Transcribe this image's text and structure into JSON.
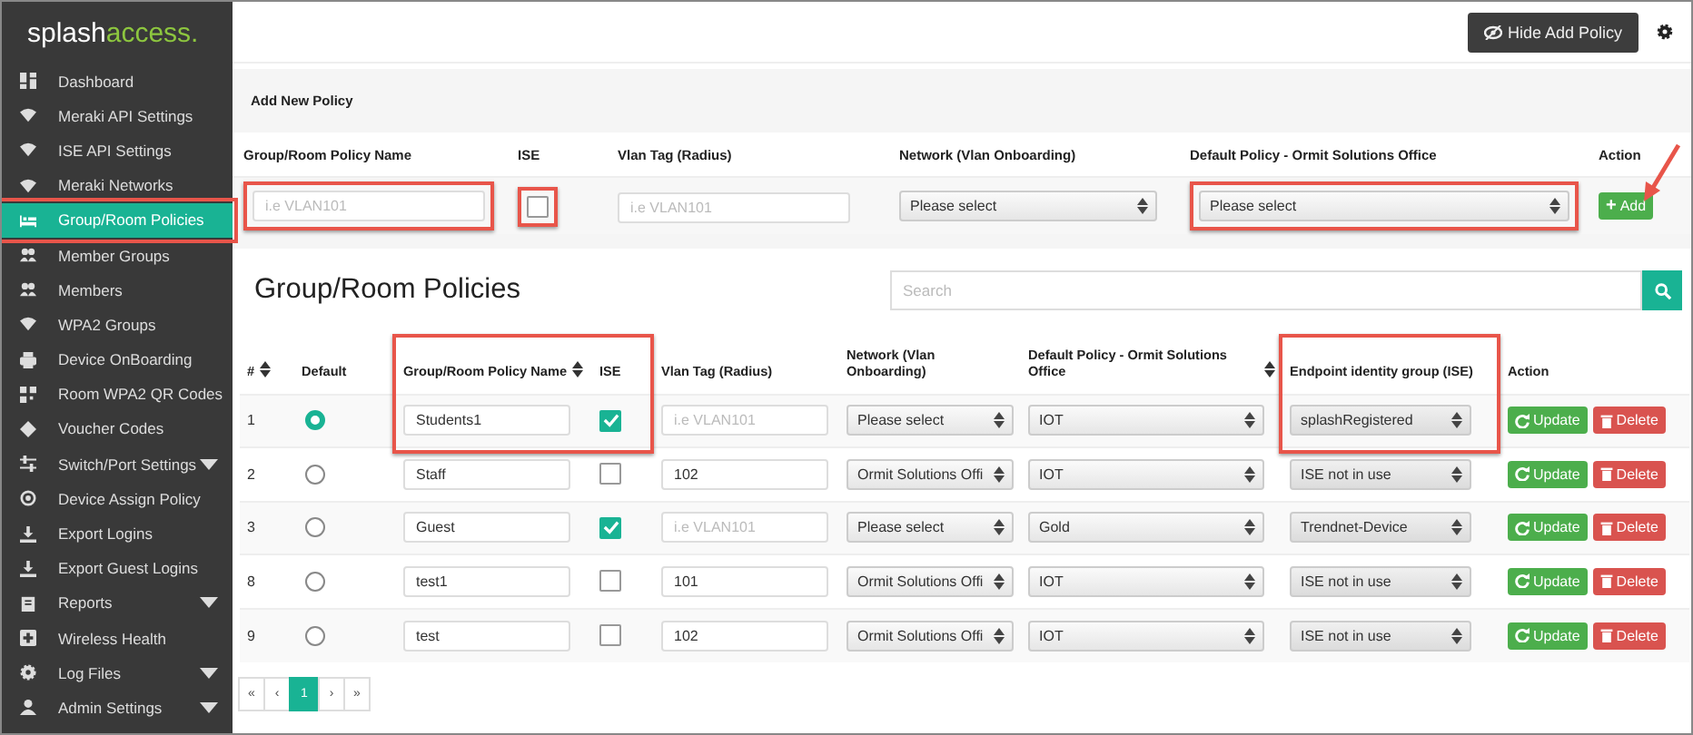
{
  "sidebar": {
    "logo": {
      "first": "splash",
      "second": "access."
    },
    "items": [
      {
        "label": "Dashboard",
        "selected": false
      },
      {
        "label": "Meraki API Settings",
        "selected": false
      },
      {
        "label": "ISE API Settings",
        "selected": false
      },
      {
        "label": "Meraki Networks",
        "selected": false
      },
      {
        "label": "Group/Room Policies",
        "selected": true
      },
      {
        "label": "Member Groups",
        "selected": false
      },
      {
        "label": "Members",
        "selected": false
      },
      {
        "label": "WPA2 Groups",
        "selected": false
      },
      {
        "label": "Device OnBoarding",
        "selected": false
      },
      {
        "label": "Room WPA2 QR Codes",
        "selected": false
      },
      {
        "label": "Voucher Codes",
        "selected": false
      },
      {
        "label": "Switch/Port Settings",
        "selected": false,
        "has_submenu": true
      },
      {
        "label": "Device Assign Policy",
        "selected": false
      },
      {
        "label": "Export Logins",
        "selected": false
      },
      {
        "label": "Export Guest Logins",
        "selected": false
      },
      {
        "label": "Reports",
        "selected": false,
        "has_submenu": true
      },
      {
        "label": "Wireless Health",
        "selected": false
      },
      {
        "label": "Log Files",
        "selected": false,
        "has_submenu": true
      },
      {
        "label": "Admin Settings",
        "selected": false,
        "has_submenu": true
      }
    ]
  },
  "toolbar": {
    "toggle_button": "Hide Add Policy"
  },
  "add_policy": {
    "title": "Add New Policy",
    "columns": [
      "Group/Room Policy Name",
      "ISE",
      "Vlan Tag (Radius)",
      "Network (Vlan Onboarding)",
      "Default Policy - Ormit Solutions Office",
      "Action"
    ],
    "name_field": {
      "placeholder": "i.e VLAN101"
    },
    "ise": {
      "checked": false
    },
    "vlan_field": {
      "placeholder": "i.e VLAN101"
    },
    "network": {
      "value": "Please select"
    },
    "default_policy": {
      "value": "Please select"
    },
    "add_button": {
      "icon": "+",
      "label": "Add"
    }
  },
  "policies": {
    "title": "Group/Room Policies",
    "search": {
      "placeholder": "Search"
    },
    "columns": [
      {
        "label": "#",
        "sortable": true
      },
      {
        "label": "Default",
        "sortable": false
      },
      {
        "label": "Group/Room Policy Name",
        "sortable": true
      },
      {
        "label": "ISE",
        "sortable": false
      },
      {
        "label": "Vlan Tag (Radius)",
        "sortable": false
      },
      {
        "label": "Network (Vlan Onboarding)",
        "sortable": false
      },
      {
        "label": "Default Policy - Ormit Solutions Office",
        "sortable": true
      },
      {
        "label": "Endpoint identity group (ISE)",
        "sortable": false
      },
      {
        "label": "Action",
        "sortable": false
      }
    ],
    "rows": [
      {
        "number": "1",
        "default": true,
        "name": "Students1",
        "ise": true,
        "vlan": "",
        "vlan_placeholder": "i.e VLAN101",
        "network": "Please select",
        "policy": "IOT",
        "endpoint": "splashRegistered",
        "update": "Update",
        "delete": "Delete"
      },
      {
        "number": "2",
        "default": false,
        "name": "Staff",
        "ise": false,
        "vlan": "102",
        "network": "Ormit Solutions Offi",
        "policy": "IOT",
        "endpoint": "ISE not in use",
        "update": "Update",
        "delete": "Delete"
      },
      {
        "number": "3",
        "default": false,
        "name": "Guest",
        "ise": true,
        "vlan": "",
        "vlan_placeholder": "i.e VLAN101",
        "network": "Please select",
        "policy": "Gold",
        "endpoint": "Trendnet-Device",
        "update": "Update",
        "delete": "Delete"
      },
      {
        "number": "8",
        "default": false,
        "name": "test1",
        "ise": false,
        "vlan": "101",
        "network": "Ormit Solutions Offi",
        "policy": "IOT",
        "endpoint": "ISE not in use",
        "update": "Update",
        "delete": "Delete"
      },
      {
        "number": "9",
        "default": false,
        "name": "test",
        "ise": false,
        "vlan": "102",
        "network": "Ormit Solutions Offi",
        "policy": "IOT",
        "endpoint": "ISE not in use",
        "update": "Update",
        "delete": "Delete"
      }
    ],
    "pagination": [
      {
        "label": "«",
        "selected": false
      },
      {
        "label": "‹",
        "selected": false
      },
      {
        "label": "1",
        "selected": true
      },
      {
        "label": "›",
        "selected": false
      },
      {
        "label": "»",
        "selected": false
      }
    ]
  }
}
